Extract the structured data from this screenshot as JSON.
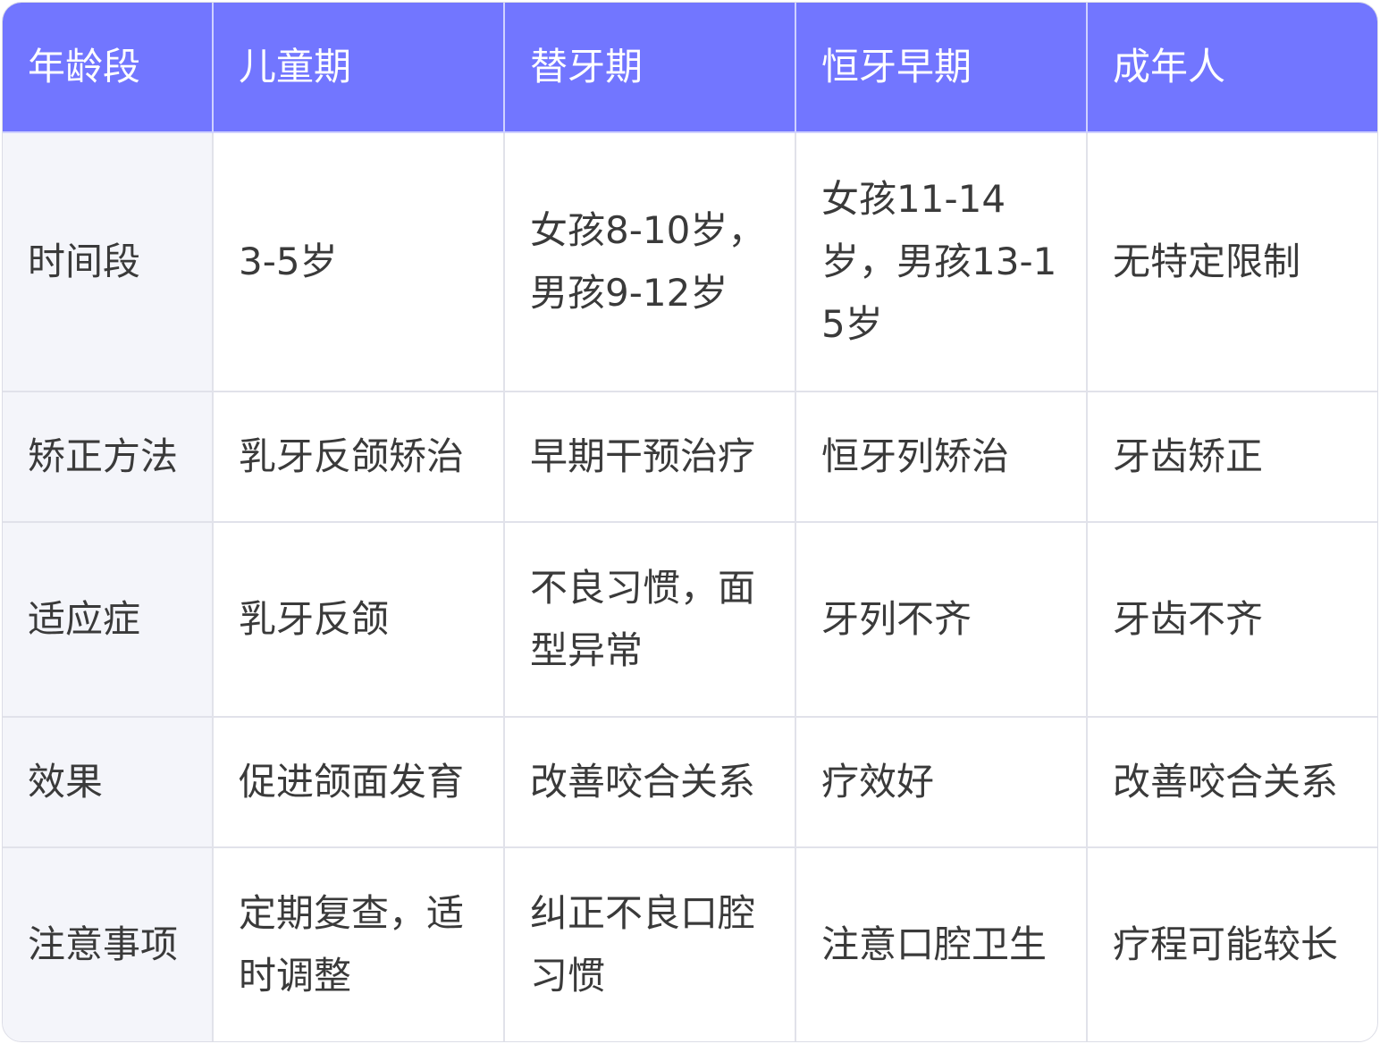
{
  "table": {
    "headers": [
      "年龄段",
      "儿童期",
      "替牙期",
      "恒牙早期",
      "成年人"
    ],
    "rows": [
      [
        "时间段",
        "3-5岁",
        "女孩8-10岁，男孩9-12岁",
        "女孩11-14岁，男孩13-15岁",
        "无特定限制"
      ],
      [
        "矫正方法",
        "乳牙反颌矫治",
        "早期干预治疗",
        "恒牙列矫治",
        "牙齿矫正"
      ],
      [
        "适应症",
        "乳牙反颌",
        "不良习惯，面型异常",
        "牙列不齐",
        "牙齿不齐"
      ],
      [
        "效果",
        "促进颌面发育",
        "改善咬合关系",
        "疗效好",
        "改善咬合关系"
      ],
      [
        "注意事项",
        "定期复查，适时调整",
        "纠正不良口腔习惯",
        "注意口腔卫生",
        "疗程可能较长"
      ]
    ]
  },
  "colors": {
    "header_bg": "#7276ff",
    "header_text": "#ffffff",
    "first_col_bg": "#f4f5fa",
    "border": "#e1e2ea",
    "text": "#3a3a3a"
  }
}
